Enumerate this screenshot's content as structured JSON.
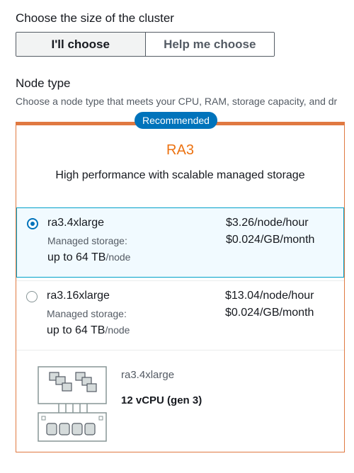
{
  "cluster_size": {
    "title": "Choose the size of the cluster",
    "options": [
      {
        "label": "I'll choose",
        "selected": true
      },
      {
        "label": "Help me choose",
        "selected": false
      }
    ]
  },
  "node_type": {
    "title": "Node type",
    "description": "Choose a node type that meets your CPU, RAM, storage capacity, and dr",
    "badge": "Recommended",
    "family": "RA3",
    "family_description": "High performance with scalable managed storage",
    "options": [
      {
        "name": "ra3.4xlarge",
        "managed_storage_label": "Managed storage:",
        "managed_storage_value": "up to 64 TB",
        "managed_storage_unit": "/node",
        "price": "$3.26/node/hour",
        "storage_price": "$0.024/GB/month",
        "selected": true
      },
      {
        "name": "ra3.16xlarge",
        "managed_storage_label": "Managed storage:",
        "managed_storage_value": "up to 64 TB",
        "managed_storage_unit": "/node",
        "price": "$13.04/node/hour",
        "storage_price": "$0.024/GB/month",
        "selected": false
      }
    ],
    "detail": {
      "name": "ra3.4xlarge",
      "vcpu": "12 vCPU (gen 3)",
      "icon": "ra3-node-diagram-icon"
    }
  },
  "colors": {
    "accent_orange": "#ec7211",
    "border_orange": "#e07941",
    "primary_blue": "#0073bb",
    "selected_bg": "#f1faff"
  }
}
